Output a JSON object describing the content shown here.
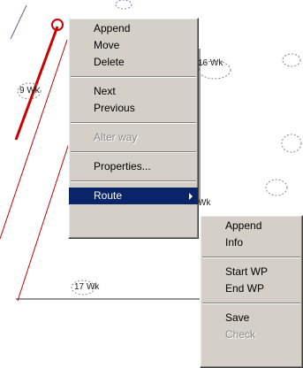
{
  "map": {
    "waypoint_labels": [
      {
        "num": "9",
        "suffix": "Wk"
      },
      {
        "num": "16",
        "suffix": "Wk"
      },
      {
        "num": "17",
        "suffix": "Wk"
      },
      {
        "num": "",
        "suffix": "Wk"
      }
    ]
  },
  "context_menu": {
    "items": [
      {
        "label": "Append"
      },
      {
        "label": "Move"
      },
      {
        "label": "Delete"
      },
      {
        "label": "Next"
      },
      {
        "label": "Previous"
      },
      {
        "label": "Alter way"
      },
      {
        "label": "Properties..."
      },
      {
        "label": "Route"
      }
    ]
  },
  "route_submenu": {
    "items": [
      {
        "label": "Append"
      },
      {
        "label": "Info"
      },
      {
        "label": "Start WP"
      },
      {
        "label": "End WP"
      },
      {
        "label": "Save"
      },
      {
        "label": "Check"
      }
    ]
  },
  "colors": {
    "menu_bg": "#d4d0c8",
    "highlight": "#0a246a",
    "route_line": "#cc0000"
  }
}
